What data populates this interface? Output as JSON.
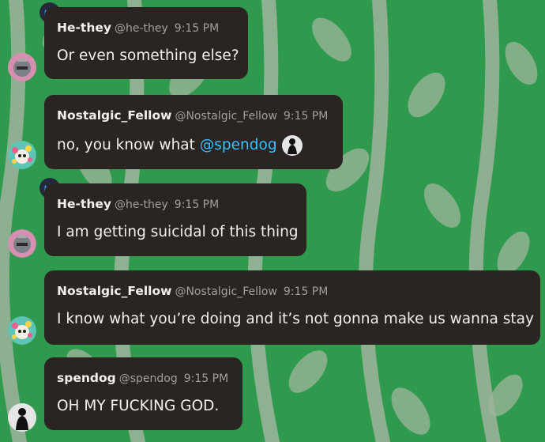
{
  "messages": [
    {
      "author": "He-they",
      "handle": "@he-they",
      "time": "9:15 PM",
      "text": "Or even something else?"
    },
    {
      "author": "Nostalgic_Fellow",
      "handle": "@Nostalgic_Fellow",
      "time": "9:15 PM",
      "text": "no, you know what",
      "mention": "@spendog"
    },
    {
      "author": "He-they",
      "handle": "@he-they",
      "time": "9:15 PM",
      "text": "I am getting suicidal of this thing"
    },
    {
      "author": "Nostalgic_Fellow",
      "handle": "@Nostalgic_Fellow",
      "time": "9:15 PM",
      "text": "I know what you’re doing and it’s not gonna make us wanna stay"
    },
    {
      "author": "spendog",
      "handle": "@spendog",
      "time": "9:15 PM",
      "text": "OH MY FUCKING GOD."
    }
  ],
  "icons": {
    "moderator": "crown-icon",
    "he_they": "knight-helmet-avatar",
    "nostalgic": "flower-skull-avatar",
    "spendog": "silhouette-avatar"
  },
  "colors": {
    "background": "#2f9a4d",
    "bubble": "#2a2523",
    "mention": "#35c2ff",
    "crown": "#3aa5ff"
  }
}
